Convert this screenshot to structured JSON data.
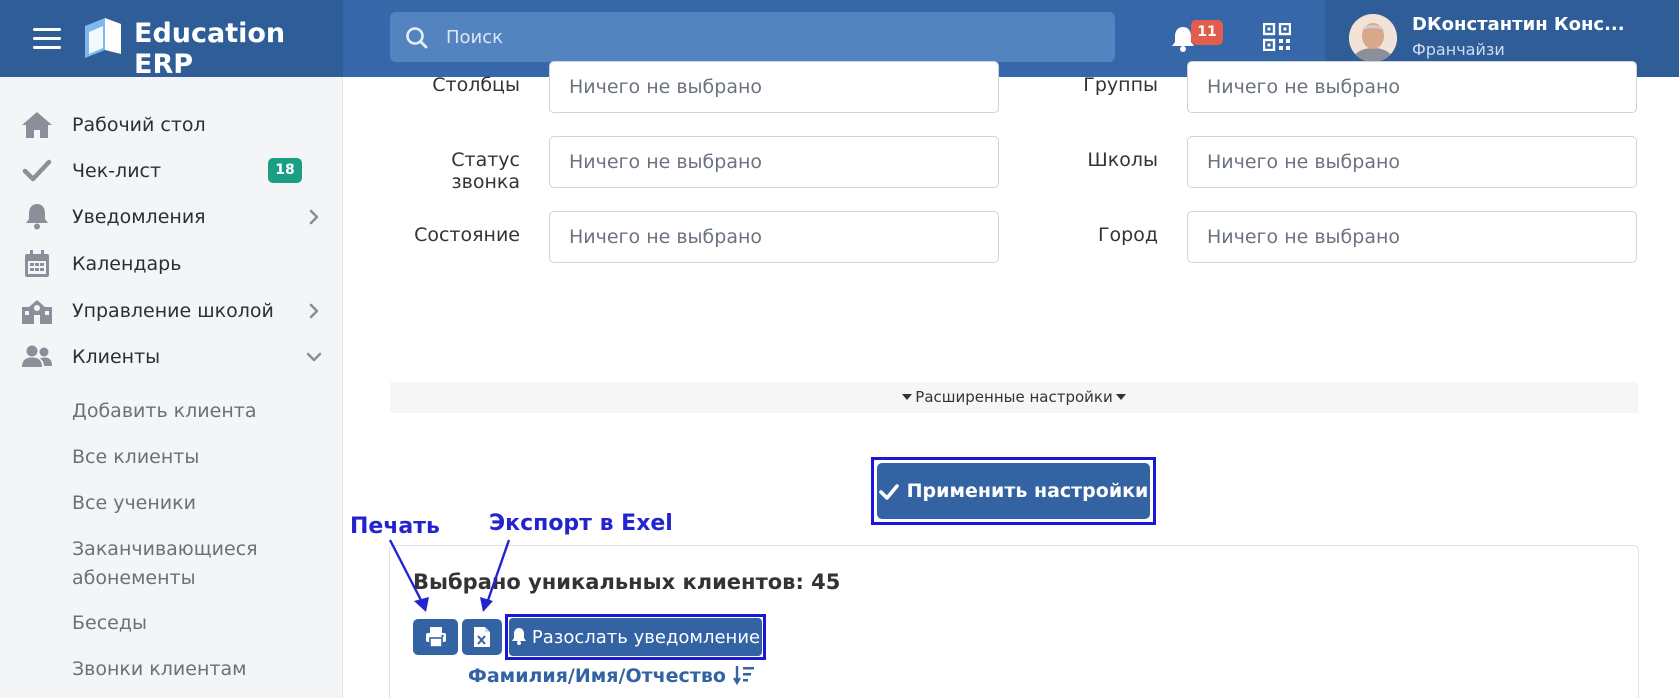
{
  "header": {
    "brand": "Education ERP",
    "search_placeholder": "Поиск",
    "notifications_count": "11",
    "user_name": "DКонстантин Конс...",
    "user_role": "Франчайзи"
  },
  "sidebar": {
    "items": [
      {
        "label": "Рабочий стол",
        "icon": "home-icon"
      },
      {
        "label": "Чек-лист",
        "icon": "check-icon",
        "badge": "18"
      },
      {
        "label": "Уведомления",
        "icon": "bell-icon"
      },
      {
        "label": "Календарь",
        "icon": "calendar-icon"
      },
      {
        "label": "Управление школой",
        "icon": "school-icon"
      },
      {
        "label": "Клиенты",
        "icon": "users-icon"
      }
    ],
    "sub_items": [
      "Добавить клиента",
      "Все клиенты",
      "Все ученики",
      "Заканчивающиеся абонементы",
      "Беседы",
      "Звонки клиентам"
    ]
  },
  "filters": {
    "left": [
      {
        "label": "Столбцы",
        "value": "Ничего не выбрано"
      },
      {
        "label": "Статус звонка",
        "value": "Ничего не выбрано"
      },
      {
        "label": "Состояние",
        "value": "Ничего не выбрано"
      }
    ],
    "right": [
      {
        "label": "Группы",
        "value": "Ничего не выбрано"
      },
      {
        "label": "Школы",
        "value": "Ничего не выбрано"
      },
      {
        "label": "Город",
        "value": "Ничего не выбрано"
      }
    ]
  },
  "advanced_settings_label": "Расширенные настройки",
  "apply_button": "Применить настройки",
  "results": {
    "title": "Выбрано уникальных клиентов: 45",
    "notify_button": "Разослать уведомление",
    "sort_link": "Фамилия/Имя/Отчество"
  },
  "annotations": {
    "print": "Печать",
    "export": "Экспорт в Exel"
  },
  "colors": {
    "header": "#3667a8",
    "header_dark": "#2f5d98",
    "button": "#3363a3",
    "annotation": "#2424cf",
    "badge_green": "#1a9e84",
    "badge_red": "#e35d4d"
  }
}
